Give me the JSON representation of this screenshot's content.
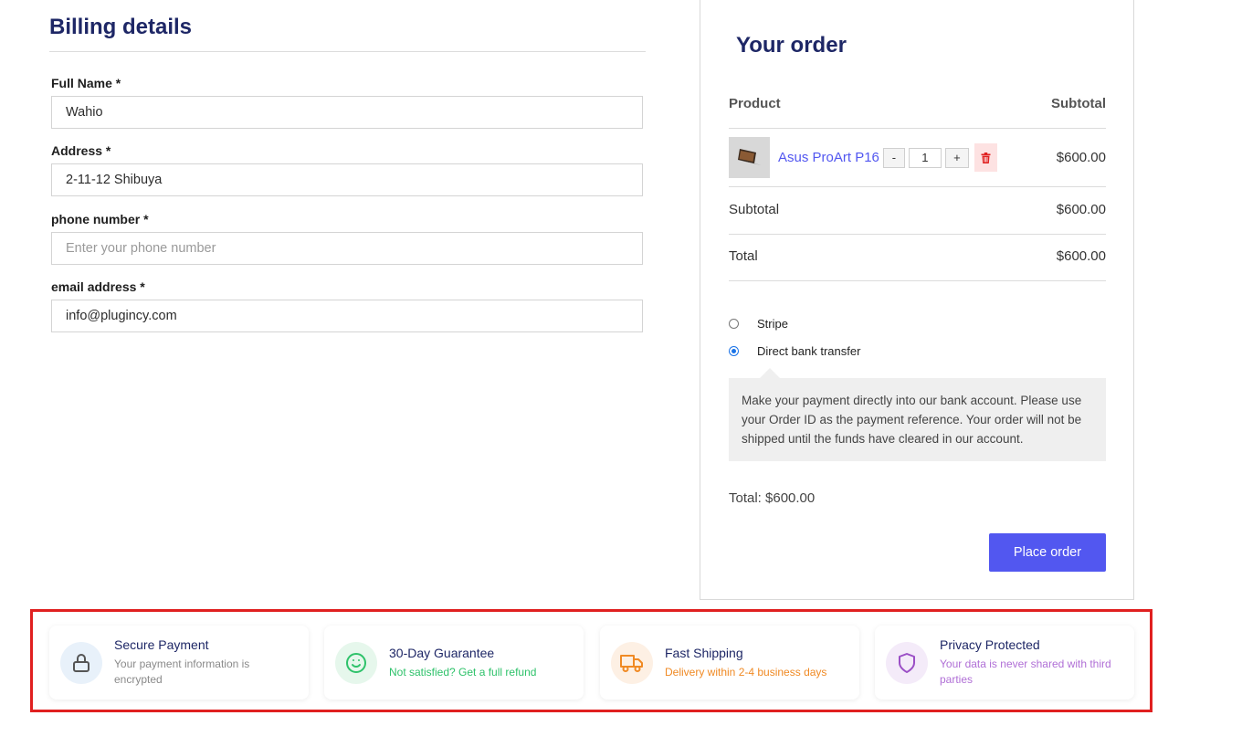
{
  "billing": {
    "title": "Billing details",
    "fields": [
      {
        "label": "Full Name *",
        "value": "Wahio",
        "placeholder": ""
      },
      {
        "label": "Address *",
        "value": "2-11-12 Shibuya",
        "placeholder": ""
      },
      {
        "label": "phone number *",
        "value": "",
        "placeholder": "Enter your phone number"
      },
      {
        "label": "email address *",
        "value": "info@plugincy.com",
        "placeholder": ""
      }
    ]
  },
  "order": {
    "title": "Your order",
    "col_product": "Product",
    "col_subtotal": "Subtotal",
    "item": {
      "name": "Asus ProArt P16",
      "qty": "1",
      "minus": "-",
      "plus": "+",
      "price": "$600.00"
    },
    "subtotal_label": "Subtotal",
    "subtotal_value": "$600.00",
    "total_label": "Total",
    "total_value": "$600.00",
    "payment_methods": [
      {
        "label": "Stripe",
        "selected": false
      },
      {
        "label": "Direct bank transfer",
        "selected": true
      }
    ],
    "bank_notice": "Make your payment directly into our bank account. Please use your Order ID as the payment reference. Your order will not be shipped until the funds have cleared in our account.",
    "total_line": "Total: $600.00",
    "place_order": "Place order"
  },
  "badges": [
    {
      "title": "Secure Payment",
      "subtitle": "Your payment information is encrypted",
      "icon": "lock-icon",
      "bg": "#e8f1fa",
      "fg": "#555555",
      "sub_color": "#8a8a8a"
    },
    {
      "title": "30-Day Guarantee",
      "subtitle": "Not satisfied? Get a full refund",
      "icon": "smile-icon",
      "bg": "#e6f7ec",
      "fg": "#2ec26a",
      "sub_color": "#2ec26a"
    },
    {
      "title": "Fast Shipping",
      "subtitle": "Delivery within 2-4 business days",
      "icon": "truck-icon",
      "bg": "#fdf0e4",
      "fg": "#f08a24",
      "sub_color": "#f08a24"
    },
    {
      "title": "Privacy Protected",
      "subtitle": "Your data is never shared with third parties",
      "icon": "shield-icon",
      "bg": "#f4ebf9",
      "fg": "#9b4fc6",
      "sub_color": "#b06fd6"
    }
  ],
  "colors": {
    "accent": "#5257f0",
    "heading": "#1e2766",
    "highlight_border": "#e02020"
  }
}
